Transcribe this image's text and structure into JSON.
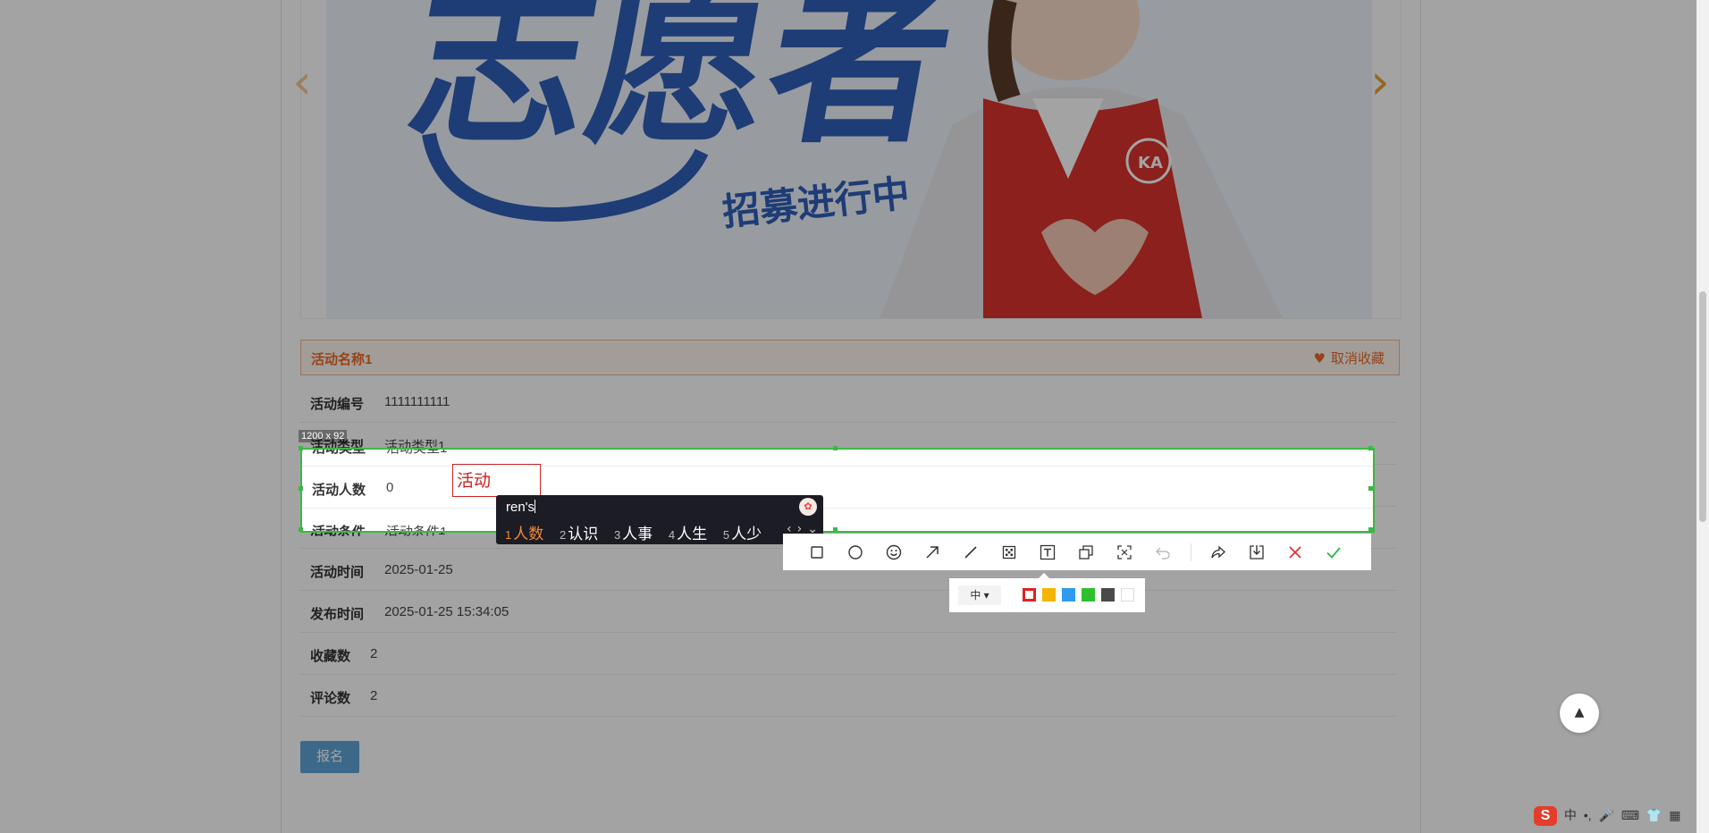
{
  "banner": {
    "headline": "志愿者",
    "sub": "招募进行中",
    "badge": "KA"
  },
  "activity": {
    "title": "活动名称1",
    "fav_label": "取消收藏",
    "fields": [
      {
        "label": "活动编号",
        "value": "1111111111"
      },
      {
        "label": "活动类型",
        "value": "活动类型1"
      },
      {
        "label": "活动人数",
        "value": "0"
      },
      {
        "label": "活动条件",
        "value": "活动条件1"
      },
      {
        "label": "活动时间",
        "value": "2025-01-25"
      },
      {
        "label": "发布时间",
        "value": "2025-01-25 15:34:05"
      },
      {
        "label": "收藏数",
        "value": "2"
      },
      {
        "label": "评论数",
        "value": "2"
      }
    ],
    "signup_label": "报名"
  },
  "screenshot_tool": {
    "size_label": "1200 x 92",
    "text_annotation": "活动",
    "tools": [
      "rectangle-tool",
      "ellipse-tool",
      "emoji-tool",
      "arrow-tool",
      "line-tool",
      "mosaic-tool",
      "text-tool",
      "pin-tool",
      "ocr-tool",
      "undo-tool",
      "share-tool",
      "save-tool",
      "cancel-tool",
      "confirm-tool"
    ],
    "font_size_label": "中",
    "colors": [
      "#e02020",
      "#f5b400",
      "#2e9bf0",
      "#2ec02e",
      "#4a4a4a",
      "#ffffff"
    ]
  },
  "ime": {
    "composition": "ren's",
    "candidates": [
      {
        "n": "1",
        "text": "人数"
      },
      {
        "n": "2",
        "text": "认识"
      },
      {
        "n": "3",
        "text": "人事"
      },
      {
        "n": "4",
        "text": "人生"
      },
      {
        "n": "5",
        "text": "人少"
      }
    ]
  },
  "taskbar": {
    "ime_logo": "S",
    "lang": "中",
    "punct": "•,"
  }
}
